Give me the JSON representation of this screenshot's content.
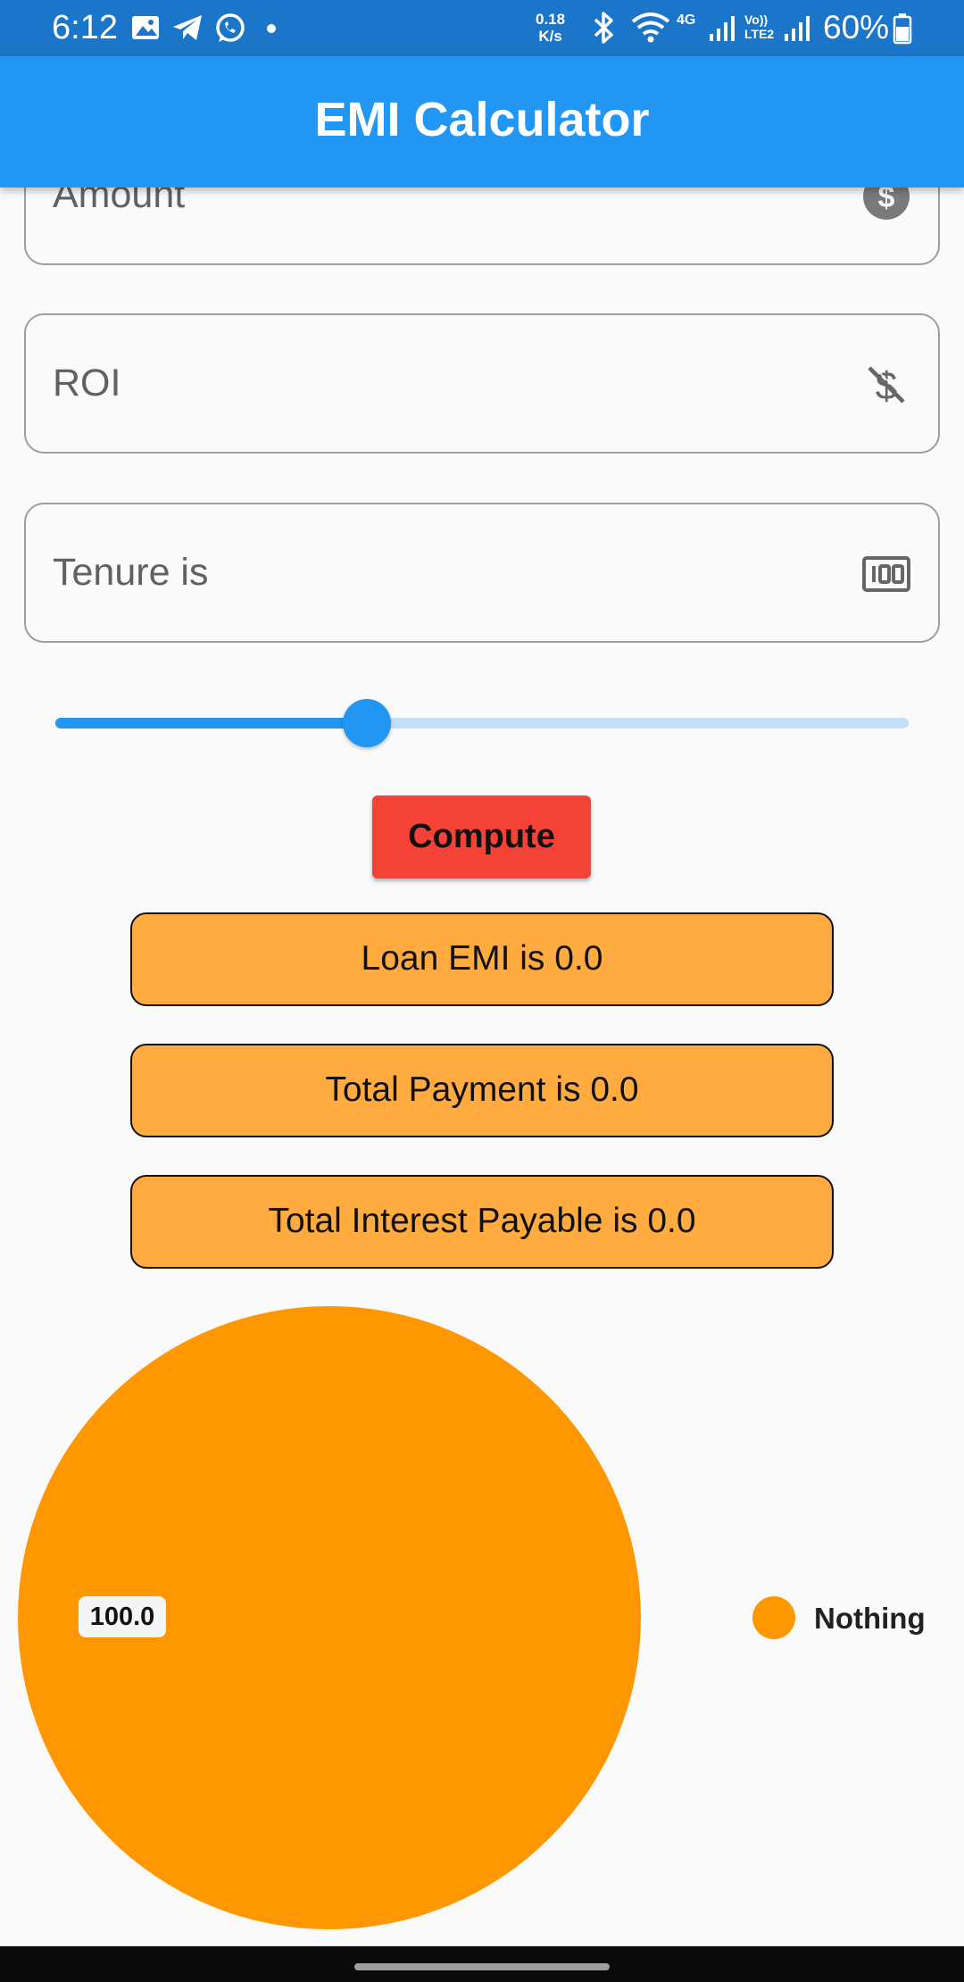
{
  "status_bar": {
    "time": "6:12",
    "speed_value": "0.18",
    "speed_unit": "K/s",
    "network_label_1": "4G",
    "network_label_2": "Vo)) LTE2",
    "battery": "60%"
  },
  "app_bar": {
    "title": "EMI Calculator"
  },
  "form": {
    "amount_label": "Amount",
    "roi_label": "ROI",
    "tenure_label": "Tenure is",
    "amount_icon": "dollar-circle-icon",
    "roi_icon": "money-off-icon",
    "tenure_icon": "100-counter-icon"
  },
  "slider": {
    "value": 0.365
  },
  "buttons": {
    "compute": "Compute"
  },
  "results": {
    "loan_emi": "Loan EMI is 0.0",
    "total_payment": "Total Payment is 0.0",
    "total_interest": "Total Interest Payable is 0.0"
  },
  "colors": {
    "app_bar": "#2196f3",
    "status_bar": "#1b76c9",
    "compute_button": "#f44336",
    "result_box": "#ffab40",
    "pie": "#ff9800"
  },
  "chart_data": {
    "type": "pie",
    "slices": [
      {
        "label": "Nothing",
        "value": 100.0,
        "color": "#ff9800"
      }
    ],
    "value_labels": [
      "100.0"
    ],
    "legend": [
      "Nothing"
    ],
    "legend_position": "right"
  }
}
